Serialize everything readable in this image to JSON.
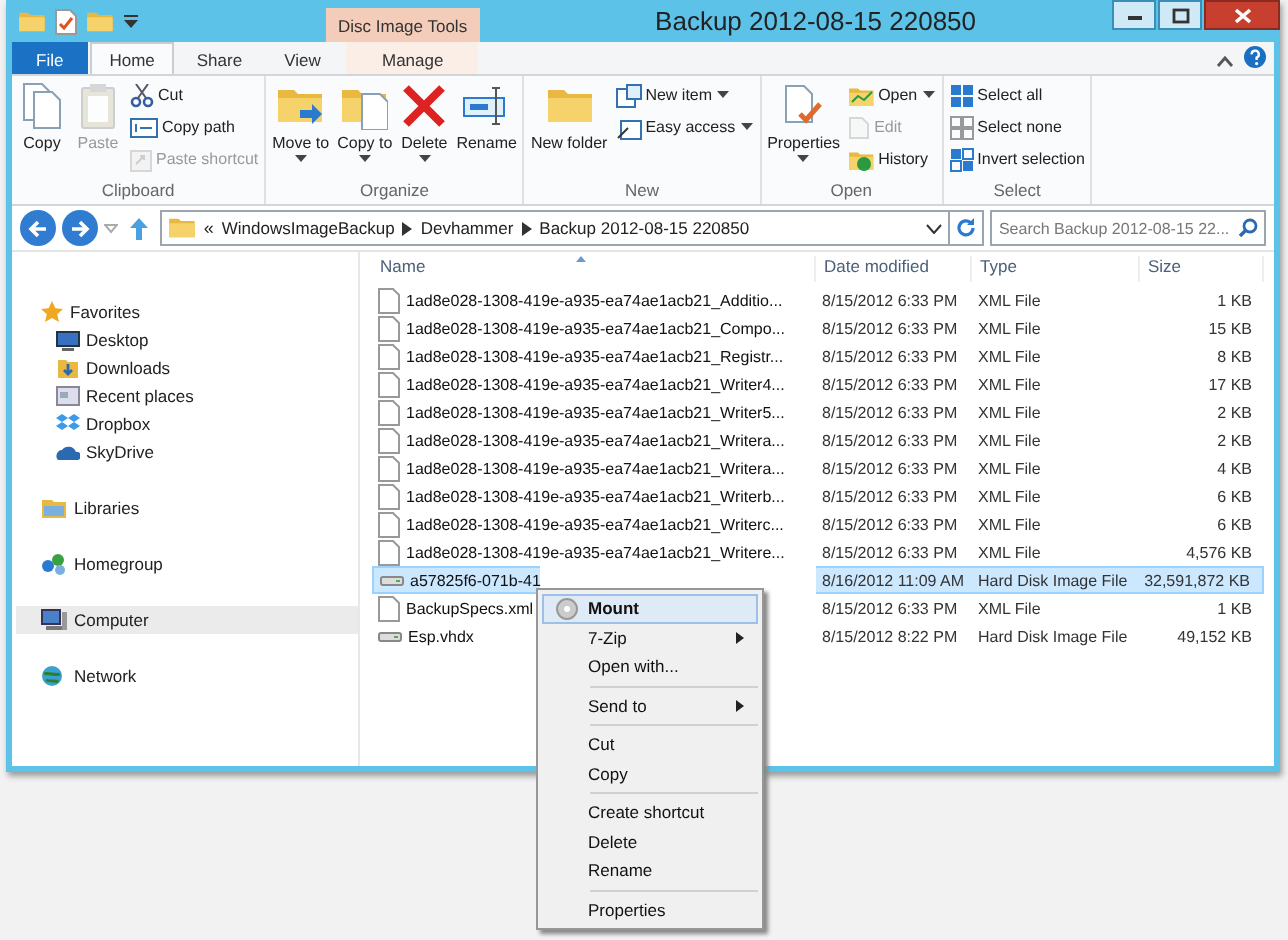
{
  "window": {
    "title": "Backup 2012-08-15 220850"
  },
  "contextual_tab": {
    "header": "Disc Image Tools"
  },
  "tabs": [
    {
      "label": "File",
      "kind": "file",
      "selected": false
    },
    {
      "label": "Home",
      "kind": "tab",
      "selected": true
    },
    {
      "label": "Share",
      "kind": "tab",
      "selected": false
    },
    {
      "label": "View",
      "kind": "tab",
      "selected": false
    },
    {
      "label": "Manage",
      "kind": "contextual",
      "selected": false
    }
  ],
  "ribbon": [
    {
      "label": "Clipboard",
      "items": [
        {
          "label": "Copy",
          "kind": "large",
          "disabled": false,
          "dropdown": false
        },
        {
          "label": "Paste",
          "kind": "large",
          "disabled": true,
          "dropdown": false
        },
        {
          "label": "Cut",
          "kind": "small",
          "disabled": false,
          "dropdown": false
        },
        {
          "label": "Copy path",
          "kind": "small",
          "disabled": false,
          "dropdown": false
        },
        {
          "label": "Paste shortcut",
          "kind": "small",
          "disabled": true,
          "dropdown": false
        }
      ]
    },
    {
      "label": "Organize",
      "items": [
        {
          "label": "Move to",
          "kind": "large",
          "disabled": false,
          "dropdown": true
        },
        {
          "label": "Copy to",
          "kind": "large",
          "disabled": false,
          "dropdown": true
        },
        {
          "label": "Delete",
          "kind": "large",
          "disabled": false,
          "dropdown": true
        },
        {
          "label": "Rename",
          "kind": "large",
          "disabled": false,
          "dropdown": false
        }
      ]
    },
    {
      "label": "New",
      "items": [
        {
          "label": "New folder",
          "kind": "large",
          "disabled": false,
          "dropdown": false
        },
        {
          "label": "New item",
          "kind": "small",
          "disabled": false,
          "dropdown": true
        },
        {
          "label": "Easy access",
          "kind": "small",
          "disabled": false,
          "dropdown": true
        }
      ]
    },
    {
      "label": "Open",
      "items": [
        {
          "label": "Properties",
          "kind": "large",
          "disabled": false,
          "dropdown": true
        },
        {
          "label": "Open",
          "kind": "small",
          "disabled": false,
          "dropdown": true
        },
        {
          "label": "Edit",
          "kind": "small",
          "disabled": true,
          "dropdown": false
        },
        {
          "label": "History",
          "kind": "small",
          "disabled": false,
          "dropdown": false
        }
      ]
    },
    {
      "label": "Select",
      "items": [
        {
          "label": "Select all",
          "kind": "small",
          "disabled": false,
          "dropdown": false
        },
        {
          "label": "Select none",
          "kind": "small",
          "disabled": false,
          "dropdown": false
        },
        {
          "label": "Invert selection",
          "kind": "small",
          "disabled": false,
          "dropdown": false
        }
      ]
    }
  ],
  "address": {
    "overflow_mark": "«",
    "path": [
      "WindowsImageBackup",
      "Devhammer",
      "Backup 2012-08-15 220850"
    ]
  },
  "search": {
    "placeholder": "Search Backup 2012-08-15 22..."
  },
  "nav": [
    {
      "label": "Favorites",
      "selected": false,
      "children": [
        {
          "label": "Desktop",
          "selected": false
        },
        {
          "label": "Downloads",
          "selected": false
        },
        {
          "label": "Recent places",
          "selected": false
        },
        {
          "label": "Dropbox",
          "selected": false
        },
        {
          "label": "SkyDrive",
          "selected": false
        }
      ]
    },
    {
      "label": "Libraries",
      "selected": false
    },
    {
      "label": "Homegroup",
      "selected": false
    },
    {
      "label": "Computer",
      "selected": true
    },
    {
      "label": "Network",
      "selected": false
    }
  ],
  "table": {
    "columns": [
      "Name",
      "Date modified",
      "Type",
      "Size"
    ],
    "rows": [
      {
        "kind": "xml",
        "selected": false,
        "cells": [
          "1ad8e028-1308-419e-a935-ea74ae1acb21_Additio...",
          "8/15/2012 6:33 PM",
          "XML File",
          "1 KB"
        ]
      },
      {
        "kind": "xml",
        "selected": false,
        "cells": [
          "1ad8e028-1308-419e-a935-ea74ae1acb21_Compo...",
          "8/15/2012 6:33 PM",
          "XML File",
          "15 KB"
        ]
      },
      {
        "kind": "xml",
        "selected": false,
        "cells": [
          "1ad8e028-1308-419e-a935-ea74ae1acb21_Registr...",
          "8/15/2012 6:33 PM",
          "XML File",
          "8 KB"
        ]
      },
      {
        "kind": "xml",
        "selected": false,
        "cells": [
          "1ad8e028-1308-419e-a935-ea74ae1acb21_Writer4...",
          "8/15/2012 6:33 PM",
          "XML File",
          "17 KB"
        ]
      },
      {
        "kind": "xml",
        "selected": false,
        "cells": [
          "1ad8e028-1308-419e-a935-ea74ae1acb21_Writer5...",
          "8/15/2012 6:33 PM",
          "XML File",
          "2 KB"
        ]
      },
      {
        "kind": "xml",
        "selected": false,
        "cells": [
          "1ad8e028-1308-419e-a935-ea74ae1acb21_Writera...",
          "8/15/2012 6:33 PM",
          "XML File",
          "2 KB"
        ]
      },
      {
        "kind": "xml",
        "selected": false,
        "cells": [
          "1ad8e028-1308-419e-a935-ea74ae1acb21_Writera...",
          "8/15/2012 6:33 PM",
          "XML File",
          "4 KB"
        ]
      },
      {
        "kind": "xml",
        "selected": false,
        "cells": [
          "1ad8e028-1308-419e-a935-ea74ae1acb21_Writerb...",
          "8/15/2012 6:33 PM",
          "XML File",
          "6 KB"
        ]
      },
      {
        "kind": "xml",
        "selected": false,
        "cells": [
          "1ad8e028-1308-419e-a935-ea74ae1acb21_Writerc...",
          "8/15/2012 6:33 PM",
          "XML File",
          "6 KB"
        ]
      },
      {
        "kind": "xml",
        "selected": false,
        "cells": [
          "1ad8e028-1308-419e-a935-ea74ae1acb21_Writere...",
          "8/15/2012 6:33 PM",
          "XML File",
          "4,576 KB"
        ]
      },
      {
        "kind": "disk",
        "selected": true,
        "cells": [
          "a57825f6-071b-41",
          "8/16/2012 11:09 AM",
          "Hard Disk Image File",
          "32,591,872 KB"
        ]
      },
      {
        "kind": "xml",
        "selected": false,
        "cells": [
          "BackupSpecs.xml",
          "8/15/2012 6:33 PM",
          "XML File",
          "1 KB"
        ]
      },
      {
        "kind": "disk",
        "selected": false,
        "cells": [
          "Esp.vhdx",
          "8/15/2012 8:22 PM",
          "Hard Disk Image File",
          "49,152 KB"
        ]
      }
    ]
  },
  "context_menu": [
    {
      "kind": "item",
      "label": "Mount",
      "default": true,
      "submenu": false,
      "selected": true
    },
    {
      "kind": "item",
      "label": "7-Zip",
      "default": false,
      "submenu": true,
      "selected": false
    },
    {
      "kind": "item",
      "label": "Open with...",
      "default": false,
      "submenu": false,
      "selected": false
    },
    {
      "kind": "separator"
    },
    {
      "kind": "item",
      "label": "Send to",
      "default": false,
      "submenu": true,
      "selected": false
    },
    {
      "kind": "separator"
    },
    {
      "kind": "item",
      "label": "Cut",
      "default": false,
      "submenu": false,
      "selected": false
    },
    {
      "kind": "item",
      "label": "Copy",
      "default": false,
      "submenu": false,
      "selected": false
    },
    {
      "kind": "separator"
    },
    {
      "kind": "item",
      "label": "Create shortcut",
      "default": false,
      "submenu": false,
      "selected": false
    },
    {
      "kind": "item",
      "label": "Delete",
      "default": false,
      "submenu": false,
      "selected": false
    },
    {
      "kind": "item",
      "label": "Rename",
      "default": false,
      "submenu": false,
      "selected": false
    },
    {
      "kind": "separator"
    },
    {
      "kind": "item",
      "label": "Properties",
      "default": false,
      "submenu": false,
      "selected": false
    }
  ]
}
